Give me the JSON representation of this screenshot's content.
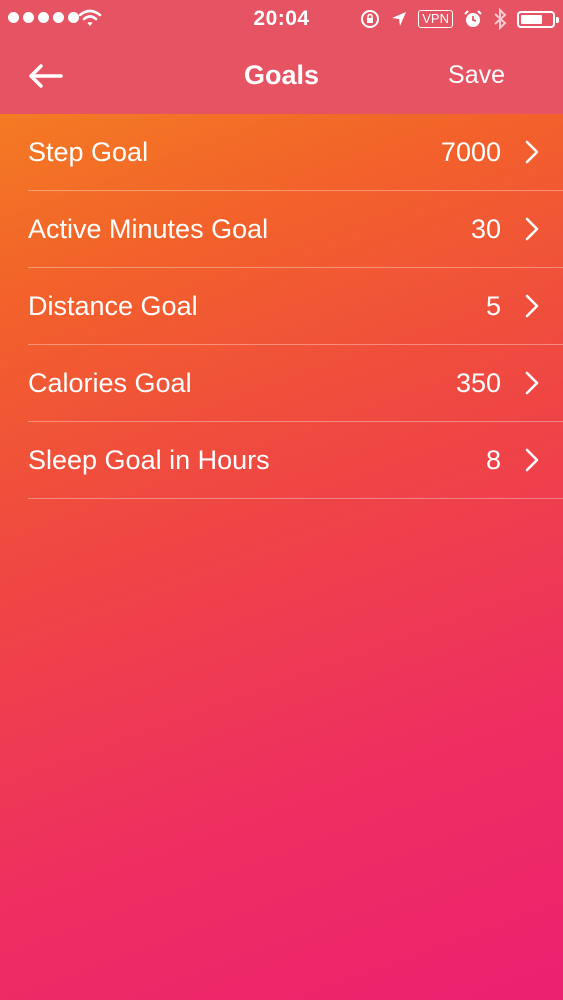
{
  "status_bar": {
    "time": "20:04",
    "vpn": "VPN",
    "icons": [
      "signal-dots-icon",
      "wifi-icon",
      "rotation-lock-icon",
      "location-icon",
      "alarm-icon",
      "bluetooth-icon",
      "battery-icon"
    ],
    "battery_level": 0.7
  },
  "nav": {
    "back_icon": "arrow-left-icon",
    "title": "Goals",
    "save_label": "Save"
  },
  "goals": [
    {
      "label": "Step Goal",
      "value": "7000"
    },
    {
      "label": "Active Minutes Goal",
      "value": "30"
    },
    {
      "label": "Distance Goal",
      "value": "5"
    },
    {
      "label": "Calories Goal",
      "value": "350"
    },
    {
      "label": "Sleep Goal in Hours",
      "value": "8"
    }
  ],
  "colors": {
    "header_bg": "#e65363",
    "gradient_start": "#f58a1f",
    "gradient_end": "#ec2170",
    "text": "#ffffff"
  }
}
